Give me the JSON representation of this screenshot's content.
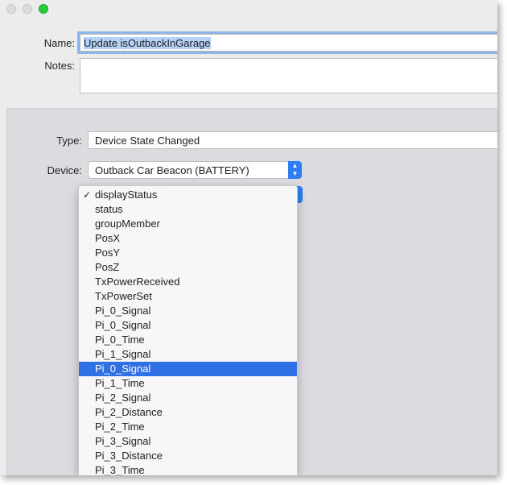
{
  "form": {
    "name_label": "Name:",
    "name_value": "Update isOutbackInGarage",
    "notes_label": "Notes:",
    "notes_value": "",
    "type_label": "Type:",
    "type_value": "Device State Changed",
    "device_label": "Device:",
    "device_value": "Outback Car Beacon (BATTERY)"
  },
  "state_menu": {
    "items": [
      "displayStatus",
      "status",
      "groupMember",
      "PosX",
      "PosY",
      "PosZ",
      "TxPowerReceived",
      "TxPowerSet",
      "Pi_0_Signal",
      "Pi_0_Signal",
      "Pi_0_Time",
      "Pi_1_Signal",
      "Pi_0_Signal",
      "Pi_1_Time",
      "Pi_2_Signal",
      "Pi_2_Distance",
      "Pi_2_Time",
      "Pi_3_Signal",
      "Pi_3_Distance",
      "Pi_3_Time"
    ],
    "checked_index": 0,
    "highlighted_index": 12,
    "checkmark": "✓"
  },
  "colors": {
    "accent": "#2f71e4",
    "zoom_light": "#2ac940"
  }
}
